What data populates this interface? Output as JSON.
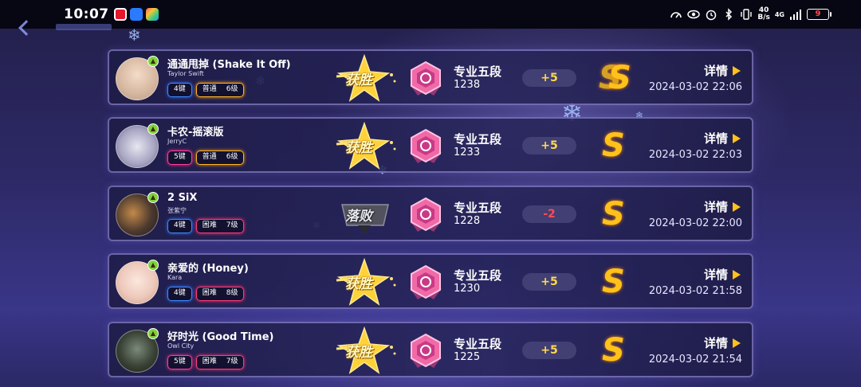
{
  "status_bar": {
    "time": "10:07",
    "net_speed_value": "40",
    "net_speed_unit": "B/s",
    "signal_label": "4G",
    "battery": "9"
  },
  "icons": {
    "back": "chevron-left-icon",
    "result_win": "win-badge-icon",
    "result_lose": "lose-badge-icon",
    "rank": "rank-emblem-icon",
    "coin": "s-coin-icon",
    "details": "play-arrow-icon"
  },
  "colors": {
    "key4": "#3d8bff",
    "key5": "#ff3d9a",
    "normal": "#ffb323",
    "hard": "#ff3b7a",
    "positive": "#ffd94a",
    "negative": "#ff4b58"
  },
  "labels": {
    "details": "详情"
  },
  "records": [
    {
      "song": "通通甩掉 (Shake It Off)",
      "artist": "Taylor Swift",
      "keys": "4键",
      "keys_class": "k4",
      "difficulty": "普通",
      "diff_class": "dnorm",
      "level": "6级",
      "result": "获胜",
      "result_type": "win",
      "rank": "专业五段",
      "score": "1238",
      "delta": "+5",
      "delta_type": "pos",
      "date": "2024-03-02 22:06"
    },
    {
      "song": "卡农-摇滚版",
      "artist": "JerryC",
      "keys": "5键",
      "keys_class": "k5",
      "difficulty": "普通",
      "diff_class": "dnorm",
      "level": "6级",
      "result": "获胜",
      "result_type": "win",
      "rank": "专业五段",
      "score": "1233",
      "delta": "+5",
      "delta_type": "pos",
      "date": "2024-03-02 22:03"
    },
    {
      "song": "2 SiX",
      "artist": "张紫宁",
      "keys": "4键",
      "keys_class": "k4",
      "difficulty": "困难",
      "diff_class": "dhard",
      "level": "7级",
      "result": "落败",
      "result_type": "lose",
      "rank": "专业五段",
      "score": "1228",
      "delta": "-2",
      "delta_type": "neg",
      "date": "2024-03-02 22:00"
    },
    {
      "song": "亲爱的 (Honey)",
      "artist": "Kara",
      "keys": "4键",
      "keys_class": "k4",
      "difficulty": "困难",
      "diff_class": "dhard",
      "level": "8级",
      "result": "获胜",
      "result_type": "win",
      "rank": "专业五段",
      "score": "1230",
      "delta": "+5",
      "delta_type": "pos",
      "date": "2024-03-02 21:58"
    },
    {
      "song": "好时光 (Good Time)",
      "artist": "Owl City",
      "keys": "5键",
      "keys_class": "k5",
      "difficulty": "困难",
      "diff_class": "dhard",
      "level": "7级",
      "result": "获胜",
      "result_type": "win",
      "rank": "专业五段",
      "score": "1225",
      "delta": "+5",
      "delta_type": "pos",
      "date": "2024-03-02 21:54"
    }
  ]
}
